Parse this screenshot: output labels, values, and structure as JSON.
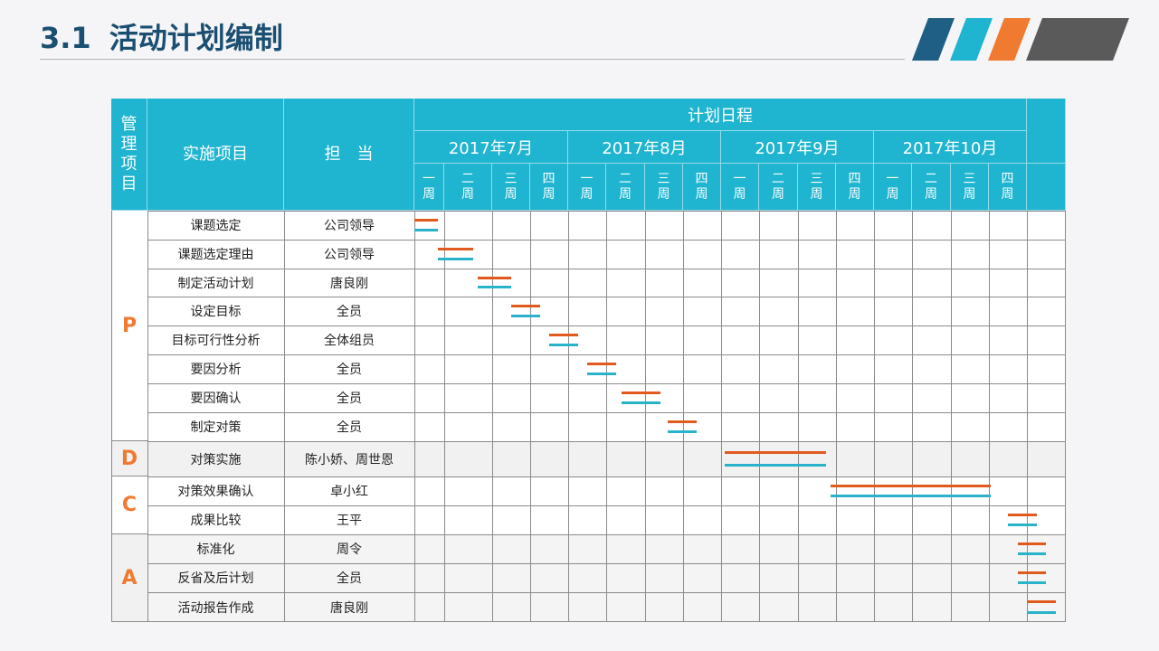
{
  "header": {
    "section_number": "3.1",
    "title": "活动计划编制"
  },
  "colors": {
    "header_bg": "#1fb4cf",
    "phase_text": "#f07a30",
    "plan_bar": "#e05a1e",
    "actual_bar": "#29b2c9",
    "title_text": "#1b4f72"
  },
  "table": {
    "col_phase": "管理项目",
    "col_item": "实施项目",
    "col_owner": "担　当",
    "schedule_label": "计划日程",
    "months": [
      "2017年7月",
      "2017年8月",
      "2017年9月",
      "2017年10月"
    ],
    "weeks": [
      "一周",
      "二周",
      "三周",
      "四周",
      "一周",
      "二周",
      "三周",
      "四周",
      "一周",
      "二周",
      "三周",
      "四周",
      "一周",
      "二周",
      "三周",
      "四周"
    ]
  },
  "phases": [
    {
      "label": "P",
      "rows": [
        0,
        1,
        2,
        3,
        4,
        5,
        6,
        7
      ]
    },
    {
      "label": "D",
      "rows": [
        8
      ]
    },
    {
      "label": "C",
      "rows": [
        9,
        10
      ]
    },
    {
      "label": "A",
      "rows": [
        11,
        12,
        13
      ]
    }
  ],
  "tasks": [
    {
      "item": "课题选定",
      "owner": "公司领导",
      "start": 0.0,
      "end": 0.8
    },
    {
      "item": "课题选定理由",
      "owner": "公司领导",
      "start": 0.8,
      "end": 1.6
    },
    {
      "item": "制定活动计划",
      "owner": "唐良刚",
      "start": 1.7,
      "end": 2.5
    },
    {
      "item": "设定目标",
      "owner": "全员",
      "start": 2.5,
      "end": 3.25
    },
    {
      "item": "目标可行性分析",
      "owner": "全体组员",
      "start": 3.5,
      "end": 4.25
    },
    {
      "item": "要因分析",
      "owner": "全员",
      "start": 4.5,
      "end": 5.25
    },
    {
      "item": "要因确认",
      "owner": "全员",
      "start": 5.4,
      "end": 6.4
    },
    {
      "item": "制定对策",
      "owner": "全员",
      "start": 6.6,
      "end": 7.35
    },
    {
      "item": "对策实施",
      "owner": "陈小娇、周世恩",
      "start": 8.1,
      "end": 10.75
    },
    {
      "item": "对策效果确认",
      "owner": "卓小红",
      "start": 10.85,
      "end": 15.05
    },
    {
      "item": "成果比较",
      "owner": "王平",
      "start": 15.5,
      "end": 16.25
    },
    {
      "item": "标准化",
      "owner": "周令",
      "start": 15.75,
      "end": 16.5
    },
    {
      "item": "反省及后计划",
      "owner": "全员",
      "start": 15.75,
      "end": 16.5
    },
    {
      "item": "活动报告作成",
      "owner": "唐良刚",
      "start": 16.0,
      "end": 16.75
    }
  ]
}
